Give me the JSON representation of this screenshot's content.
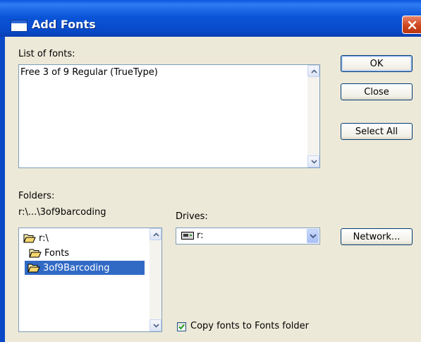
{
  "window": {
    "title": "Add Fonts"
  },
  "fonts_list": {
    "label": "List of fonts:",
    "items": [
      "Free 3 of 9 Regular (TrueType)"
    ]
  },
  "buttons": {
    "ok": "OK",
    "close": "Close",
    "select_all": "Select All",
    "network": "Network..."
  },
  "folders": {
    "label": "Folders:",
    "current_path": "r:\\...\\3of9barcoding",
    "items": [
      {
        "name": "r:\\",
        "selected": false
      },
      {
        "name": "Fonts",
        "selected": false
      },
      {
        "name": "3of9Barcoding",
        "selected": true
      }
    ]
  },
  "drives": {
    "label": "Drives:",
    "selected": "r:"
  },
  "copy_option": {
    "label": "Copy fonts to Fonts folder",
    "checked": true
  },
  "colors": {
    "titlebar": "#0A4FD6",
    "dialog_bg": "#ECE9D8",
    "selection": "#316AC5",
    "close": "#D0471F"
  }
}
